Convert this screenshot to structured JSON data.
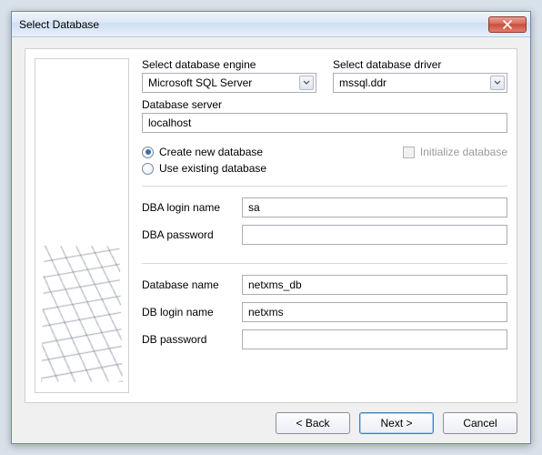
{
  "window": {
    "title": "Select Database"
  },
  "labels": {
    "engine": "Select database engine",
    "driver": "Select database driver",
    "server": "Database server",
    "create": "Create new database",
    "existing": "Use existing database",
    "init": "Initialize database",
    "dba_login": "DBA login name",
    "dba_password": "DBA password",
    "db_name": "Database name",
    "db_login": "DB login name",
    "db_password": "DB password"
  },
  "values": {
    "engine_selected": "Microsoft SQL Server",
    "driver_selected": "mssql.ddr",
    "server": "localhost",
    "dba_login": "sa",
    "dba_password": "",
    "db_name": "netxms_db",
    "db_login": "netxms",
    "db_password": ""
  },
  "buttons": {
    "back": "< Back",
    "next": "Next >",
    "cancel": "Cancel"
  }
}
